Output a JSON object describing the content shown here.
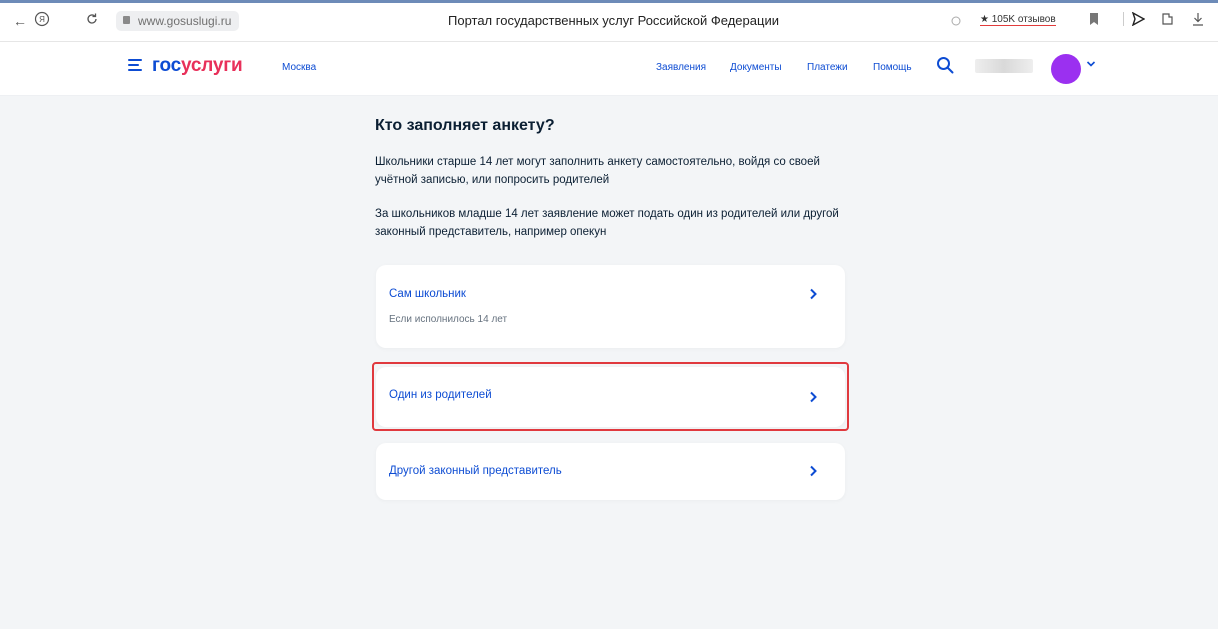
{
  "browser": {
    "url": "www.gosuslugi.ru",
    "tab_title": "Портал государственных услуг Российской Федерации",
    "reviews": "★ 105K отзывов"
  },
  "header": {
    "logo_part1": "гос",
    "logo_part2": "услуги",
    "city": "Москва",
    "nav": [
      "Заявления",
      "Документы",
      "Платежи",
      "Помощь"
    ],
    "avatar_color": "#9b30f0"
  },
  "main": {
    "title": "Кто заполняет анкету?",
    "para1": "Школьники старше 14 лет могут заполнить анкету самостоятельно, войдя со своей учётной записью, или попросить родителей",
    "para2": "За школьников младше 14 лет заявление может подать один из родителей или другой законный представитель, например опекун",
    "options": [
      {
        "label": "Сам школьник",
        "sub": "Если исполнилось 14 лет"
      },
      {
        "label": "Один из родителей"
      },
      {
        "label": "Другой законный представитель"
      }
    ]
  },
  "colors": {
    "accent": "#0d4cd3",
    "brand_red": "#e8305a",
    "background": "#f3f5f7",
    "highlight": "#e0393e"
  }
}
